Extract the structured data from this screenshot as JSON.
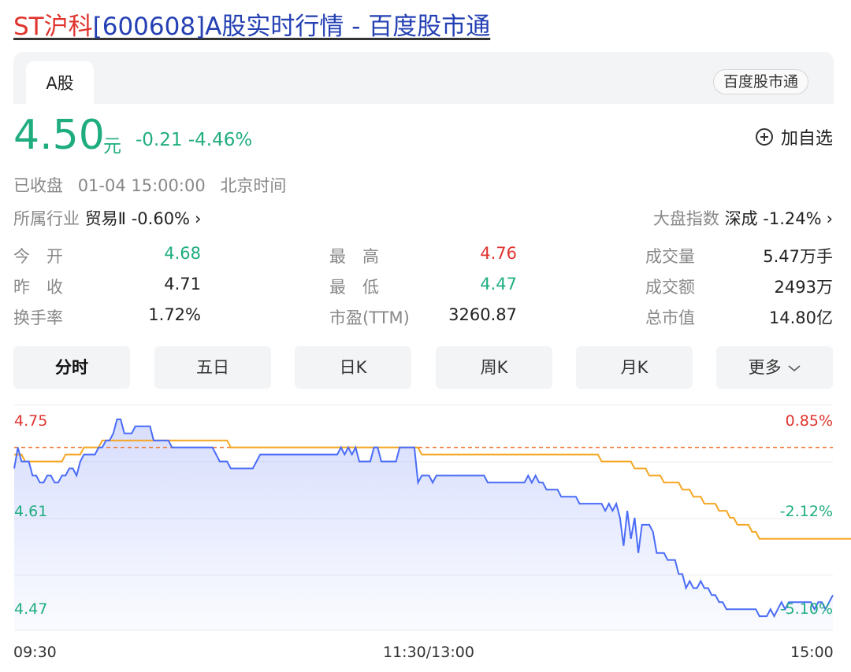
{
  "title": {
    "name": "ST沪科",
    "rest": "[600608]A股实时行情 - 百度股市通"
  },
  "tabs": {
    "active": "A股",
    "source": "百度股市通"
  },
  "quote": {
    "price": "4.50",
    "unit": "元",
    "change": "-0.21 -4.46%",
    "status": "已收盘",
    "datetime": "01-04 15:00:00",
    "timezone": "北京时间",
    "add_watch": "加自选"
  },
  "industry": {
    "label": "所属行业",
    "name": "贸易Ⅱ",
    "change": "-0.60%"
  },
  "market_index": {
    "label": "大盘指数",
    "name": "深成",
    "change": "-1.24%"
  },
  "stats": {
    "open": {
      "label": "今　开",
      "value": "4.68"
    },
    "prev_close": {
      "label": "昨　收",
      "value": "4.71"
    },
    "turnover_rate": {
      "label": "换手率",
      "value": "1.72%"
    },
    "high": {
      "label": "最　高",
      "value": "4.76"
    },
    "low": {
      "label": "最　低",
      "value": "4.47"
    },
    "pe": {
      "label": "市盈(TTM)",
      "value": "3260.87"
    },
    "volume": {
      "label": "成交量",
      "value": "5.47万手"
    },
    "amount": {
      "label": "成交额",
      "value": "2493万"
    },
    "market_cap": {
      "label": "总市值",
      "value": "14.80亿"
    }
  },
  "period_tabs": [
    "分时",
    "五日",
    "日K",
    "周K",
    "月K",
    "更多"
  ],
  "colors": {
    "up": "#e0332e",
    "down": "#1fad80",
    "price_line": "#4a6cf7",
    "avg_line": "#f5a623",
    "ref_line": "#f07a3a"
  },
  "chart_data": {
    "type": "line",
    "ylim": [
      4.45,
      4.77
    ],
    "y_ticks_left": [
      "4.75",
      "4.61",
      "4.47"
    ],
    "y_ticks_right": [
      "0.85%",
      "-2.12%",
      "-5.10%"
    ],
    "x_ticks": [
      "09:30",
      "11:30/13:00",
      "15:00"
    ],
    "reference": 4.71,
    "series": [
      {
        "values": [
          4.68,
          4.71,
          4.69,
          4.69,
          4.69,
          4.67,
          4.67,
          4.66,
          4.66,
          4.67,
          4.67,
          4.66,
          4.66,
          4.67,
          4.67,
          4.68,
          4.68,
          4.67,
          4.69,
          4.7,
          4.7,
          4.7,
          4.7,
          4.71,
          4.71,
          4.72,
          4.72,
          4.73,
          4.75,
          4.75,
          4.73,
          4.73,
          4.73,
          4.74,
          4.74,
          4.74,
          4.74,
          4.74,
          4.72,
          4.72,
          4.72,
          4.72,
          4.72,
          4.71,
          4.71,
          4.71,
          4.71,
          4.71,
          4.71,
          4.71,
          4.71,
          4.71,
          4.71,
          4.71,
          4.71,
          4.7,
          4.69,
          4.69,
          4.69,
          4.68,
          4.68,
          4.68,
          4.68,
          4.68,
          4.68,
          4.68,
          4.69,
          4.7,
          4.7,
          4.7,
          4.7,
          4.7,
          4.7,
          4.7,
          4.7,
          4.7,
          4.7,
          4.7,
          4.7,
          4.7,
          4.7,
          4.7,
          4.7,
          4.7,
          4.7,
          4.7,
          4.7,
          4.7,
          4.7,
          4.71,
          4.7,
          4.71,
          4.7,
          4.71,
          4.69,
          4.69,
          4.69,
          4.69,
          4.71,
          4.71,
          4.69,
          4.69,
          4.69,
          4.69,
          4.69,
          4.71,
          4.71,
          4.71,
          4.71,
          4.71,
          4.66,
          4.67,
          4.67,
          4.67,
          4.66,
          4.67,
          4.67,
          4.67,
          4.67,
          4.67,
          4.67,
          4.67,
          4.67,
          4.67,
          4.67,
          4.67,
          4.67,
          4.67,
          4.67,
          4.66,
          4.66,
          4.66,
          4.66,
          4.66,
          4.66,
          4.66,
          4.66,
          4.66,
          4.66,
          4.66,
          4.67,
          4.66,
          4.67,
          4.66,
          4.66,
          4.65,
          4.65,
          4.65,
          4.65,
          4.64,
          4.64,
          4.64,
          4.64,
          4.64,
          4.63,
          4.63,
          4.63,
          4.63,
          4.63,
          4.63,
          4.63,
          4.62,
          4.63,
          4.62,
          4.63,
          4.61,
          4.57,
          4.62,
          4.58,
          4.61,
          4.56,
          4.6,
          4.6,
          4.6,
          4.59,
          4.56,
          4.56,
          4.56,
          4.55,
          4.55,
          4.55,
          4.53,
          4.53,
          4.51,
          4.52,
          4.51,
          4.51,
          4.52,
          4.51,
          4.51,
          4.5,
          4.5,
          4.49,
          4.49,
          4.48,
          4.48,
          4.48,
          4.48,
          4.48,
          4.48,
          4.48,
          4.48,
          4.48,
          4.47,
          4.47,
          4.47,
          4.48,
          4.47,
          4.48,
          4.49,
          4.48,
          4.49,
          4.49,
          4.49,
          4.49,
          4.49,
          4.49,
          4.49,
          4.48,
          4.49,
          4.49,
          4.48,
          4.49,
          4.5
        ]
      },
      {
        "values": [
          4.7,
          4.7,
          4.7,
          4.69,
          4.69,
          4.69,
          4.69,
          4.69,
          4.69,
          4.69,
          4.69,
          4.69,
          4.69,
          4.69,
          4.7,
          4.7,
          4.7,
          4.7,
          4.7,
          4.71,
          4.71,
          4.71,
          4.71,
          4.71,
          4.72,
          4.72,
          4.72,
          4.72,
          4.72,
          4.72,
          4.72,
          4.72,
          4.72,
          4.72,
          4.72,
          4.72,
          4.72,
          4.72,
          4.72,
          4.72,
          4.72,
          4.72,
          4.72,
          4.72,
          4.72,
          4.72,
          4.72,
          4.72,
          4.72,
          4.72,
          4.72,
          4.72,
          4.72,
          4.72,
          4.72,
          4.72,
          4.72,
          4.72,
          4.72,
          4.71,
          4.71,
          4.71,
          4.71,
          4.71,
          4.71,
          4.71,
          4.71,
          4.71,
          4.71,
          4.71,
          4.71,
          4.71,
          4.71,
          4.71,
          4.71,
          4.71,
          4.71,
          4.71,
          4.71,
          4.71,
          4.71,
          4.71,
          4.71,
          4.71,
          4.71,
          4.71,
          4.71,
          4.71,
          4.71,
          4.71,
          4.71,
          4.71,
          4.71,
          4.71,
          4.71,
          4.71,
          4.71,
          4.71,
          4.71,
          4.71,
          4.71,
          4.71,
          4.71,
          4.71,
          4.71,
          4.71,
          4.71,
          4.71,
          4.71,
          4.71,
          4.71,
          4.7,
          4.7,
          4.7,
          4.7,
          4.7,
          4.7,
          4.7,
          4.7,
          4.7,
          4.7,
          4.7,
          4.7,
          4.7,
          4.7,
          4.7,
          4.7,
          4.7,
          4.7,
          4.7,
          4.7,
          4.7,
          4.7,
          4.7,
          4.7,
          4.7,
          4.7,
          4.7,
          4.7,
          4.7,
          4.7,
          4.7,
          4.7,
          4.7,
          4.7,
          4.7,
          4.7,
          4.7,
          4.7,
          4.7,
          4.7,
          4.7,
          4.7,
          4.7,
          4.7,
          4.7,
          4.7,
          4.7,
          4.7,
          4.7,
          4.69,
          4.69,
          4.69,
          4.69,
          4.69,
          4.69,
          4.69,
          4.69,
          4.69,
          4.68,
          4.68,
          4.68,
          4.68,
          4.67,
          4.67,
          4.67,
          4.67,
          4.66,
          4.66,
          4.66,
          4.66,
          4.66,
          4.65,
          4.65,
          4.65,
          4.64,
          4.64,
          4.64,
          4.63,
          4.63,
          4.63,
          4.63,
          4.62,
          4.62,
          4.62,
          4.61,
          4.61,
          4.6,
          4.6,
          4.6,
          4.6,
          4.59,
          4.59,
          4.58,
          4.58,
          4.58,
          4.58,
          4.58,
          4.58,
          4.58,
          4.58,
          4.58,
          4.58,
          4.58,
          4.58,
          4.58,
          4.58,
          4.58,
          4.58,
          4.58,
          4.58,
          4.58,
          4.58,
          4.58,
          4.58,
          4.58,
          4.58,
          4.58,
          4.58,
          4.58,
          4.58,
          4.58
        ]
      }
    ]
  }
}
